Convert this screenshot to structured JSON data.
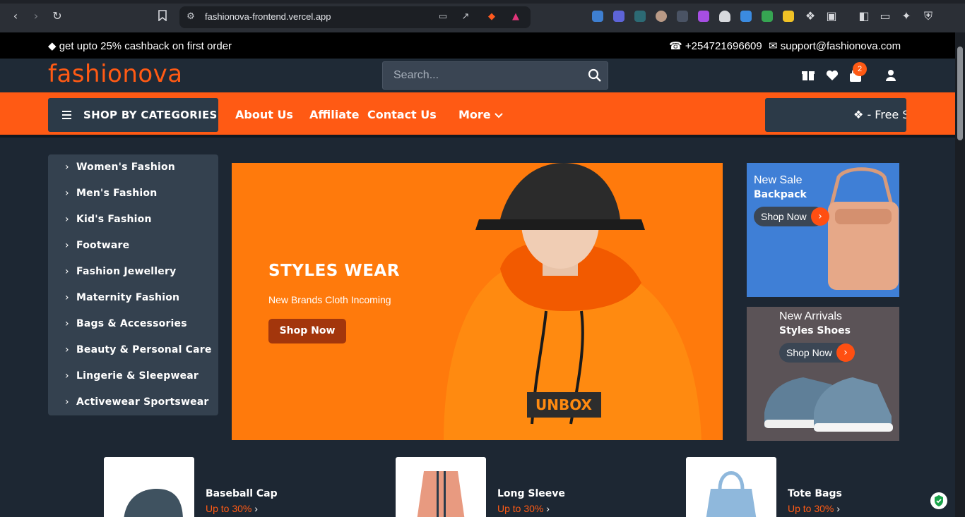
{
  "browser": {
    "url": "fashionova-frontend.vercel.app",
    "icons": [
      "back-icon",
      "forward-icon",
      "reload-icon",
      "bookmark-icon",
      "site-settings-icon",
      "cast-icon",
      "share-icon",
      "brave-shield-icon",
      "brave-rewards-icon",
      "extensions-icon",
      "sidebar-icon",
      "wallet-icon",
      "leo-icon",
      "vpn-icon"
    ]
  },
  "topbar": {
    "promo": "get upto 25% cashback on first order",
    "phone": "+254721696609",
    "email": "support@fashionova.com"
  },
  "header": {
    "logo": "fashionova",
    "search_placeholder": "Search...",
    "cart_count": "2"
  },
  "nav": {
    "categories_button": "SHOP BY CATEGORIES",
    "links": [
      "About Us",
      "Affiliate",
      "Contact Us",
      "More"
    ],
    "free_shipping": "- Free S"
  },
  "sidebar": {
    "items": [
      "Women's Fashion",
      "Men's Fashion",
      "Kid's Fashion",
      "Footware",
      "Fashion Jewellery",
      "Maternity Fashion",
      "Bags & Accessories",
      "Beauty & Personal Care",
      "Lingerie & Sleepwear",
      "Activewear Sportswear"
    ]
  },
  "hero": {
    "title": "STYLES WEAR",
    "subtitle": "New Brands Cloth Incoming",
    "button": "Shop Now",
    "hoodie_print": "UNBOX"
  },
  "banners": [
    {
      "line1": "New Sale",
      "line2": "Backpack",
      "button": "Shop Now"
    },
    {
      "line1": "New Arrivals",
      "line2": "Styles Shoes",
      "button": "Shop Now"
    }
  ],
  "products": [
    {
      "name": "Baseball Cap",
      "offer": "Up to 30%"
    },
    {
      "name": "Long Sleeve",
      "offer": "Up to 30%"
    },
    {
      "name": "Tote Bags",
      "offer": "Up to 30%"
    }
  ],
  "colors": {
    "accent": "#ff5a14",
    "header_bg": "#1f2a36",
    "page_bg": "#1d2733"
  }
}
